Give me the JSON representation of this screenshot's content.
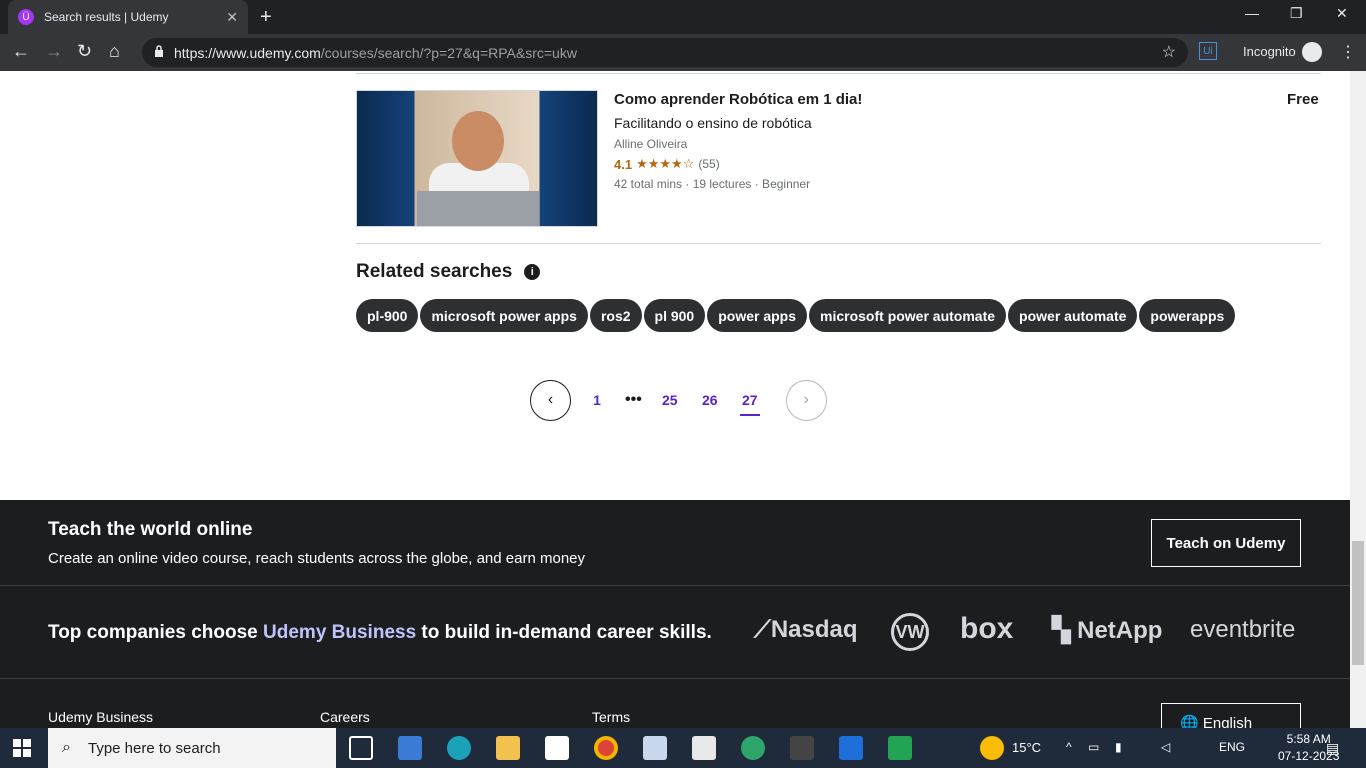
{
  "browser": {
    "tab_title": "Search results | Udemy",
    "tab_favicon": "Ü",
    "url_host": "https://www.udemy.com",
    "url_path": "/courses/search/?p=27&q=RPA&src=ukw",
    "extension_label": "Ui",
    "incognito_label": "Incognito"
  },
  "course": {
    "title": "Como aprender Robótica em 1 dia!",
    "subtitle": "Facilitando o ensino de robótica",
    "author": "Alline Oliveira",
    "rating": "4.1",
    "stars": "★★★★☆",
    "reviews": "(55)",
    "meta": "42 total mins · 19 lectures · Beginner",
    "price": "Free"
  },
  "related": {
    "title": "Related searches",
    "info_icon": "i",
    "chips": [
      "pl-900",
      "microsoft power apps",
      "ros2",
      "pl 900",
      "power apps",
      "microsoft power automate",
      "power automate",
      "powerapps"
    ]
  },
  "pagination": {
    "prev": "‹",
    "first": "1",
    "dots": "•••",
    "pages": [
      "25",
      "26",
      "27"
    ],
    "current": "27",
    "next": "›"
  },
  "footer": {
    "teach_title": "Teach the world online",
    "teach_sub": "Create an online video course, reach students across the globe, and earn money",
    "teach_button": "Teach on Udemy",
    "companies_pre": "Top companies choose ",
    "companies_highlight": "Udemy Business",
    "companies_post": " to build in-demand career skills.",
    "logos": {
      "nasdaq": "Nasdaq",
      "vw": "VW",
      "box": "box",
      "netapp": "NetApp",
      "eventbrite": "eventbrite"
    },
    "links": [
      "Udemy Business",
      "Careers",
      "Terms"
    ],
    "language_button": "English"
  },
  "taskbar": {
    "search_placeholder": "Type here to search",
    "weather": "15°C",
    "lang": "ENG",
    "time": "5:58 AM",
    "date": "07-12-2023"
  }
}
